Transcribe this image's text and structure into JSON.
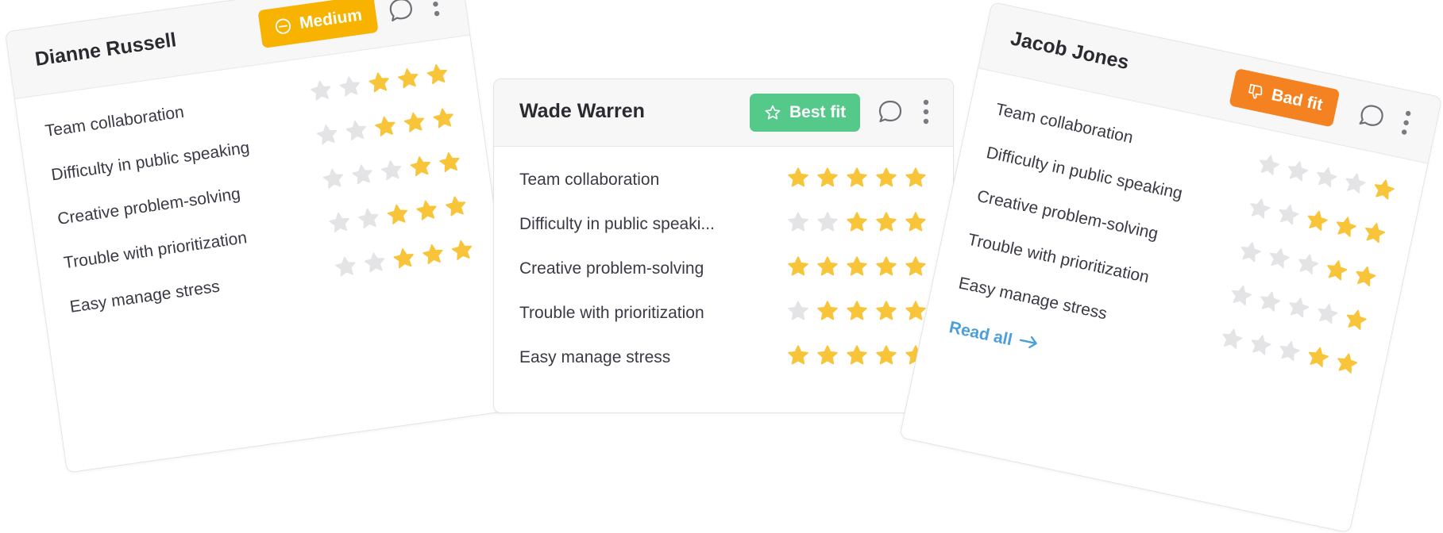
{
  "colors": {
    "star_filled": "#f8c53a",
    "star_empty": "#e4e4e6",
    "badge_medium": "#f8b300",
    "badge_best_fit": "#55c98a",
    "badge_bad_fit": "#f58220",
    "link": "#4d9fdb"
  },
  "cards": [
    {
      "name": "Dianne Russell",
      "badge": {
        "label": "Medium",
        "icon": "minus-circle-icon"
      },
      "criteria": [
        {
          "label": "Team collaboration",
          "rating": 3
        },
        {
          "label": "Difficulty in public speaking",
          "rating": 3
        },
        {
          "label": "Creative problem-solving",
          "rating": 2
        },
        {
          "label": "Trouble with prioritization",
          "rating": 3
        },
        {
          "label": "Easy manage stress",
          "rating": 3
        }
      ]
    },
    {
      "name": "Wade Warren",
      "badge": {
        "label": "Best fit",
        "icon": "star-outline-icon"
      },
      "criteria": [
        {
          "label": "Team collaboration",
          "rating": 5
        },
        {
          "label": "Difficulty in public speaki...",
          "rating": 3
        },
        {
          "label": "Creative problem-solving",
          "rating": 5
        },
        {
          "label": "Trouble with prioritization",
          "rating": 4
        },
        {
          "label": "Easy manage stress",
          "rating": 5
        }
      ]
    },
    {
      "name": "Jacob Jones",
      "badge": {
        "label": "Bad fit",
        "icon": "thumbs-down-icon"
      },
      "criteria": [
        {
          "label": "Team collaboration",
          "rating": 1
        },
        {
          "label": "Difficulty in public speaking",
          "rating": 3
        },
        {
          "label": "Creative problem-solving",
          "rating": 2
        },
        {
          "label": "Trouble with prioritization",
          "rating": 1
        },
        {
          "label": "Easy manage stress",
          "rating": 2
        }
      ],
      "read_all": "Read all"
    }
  ]
}
